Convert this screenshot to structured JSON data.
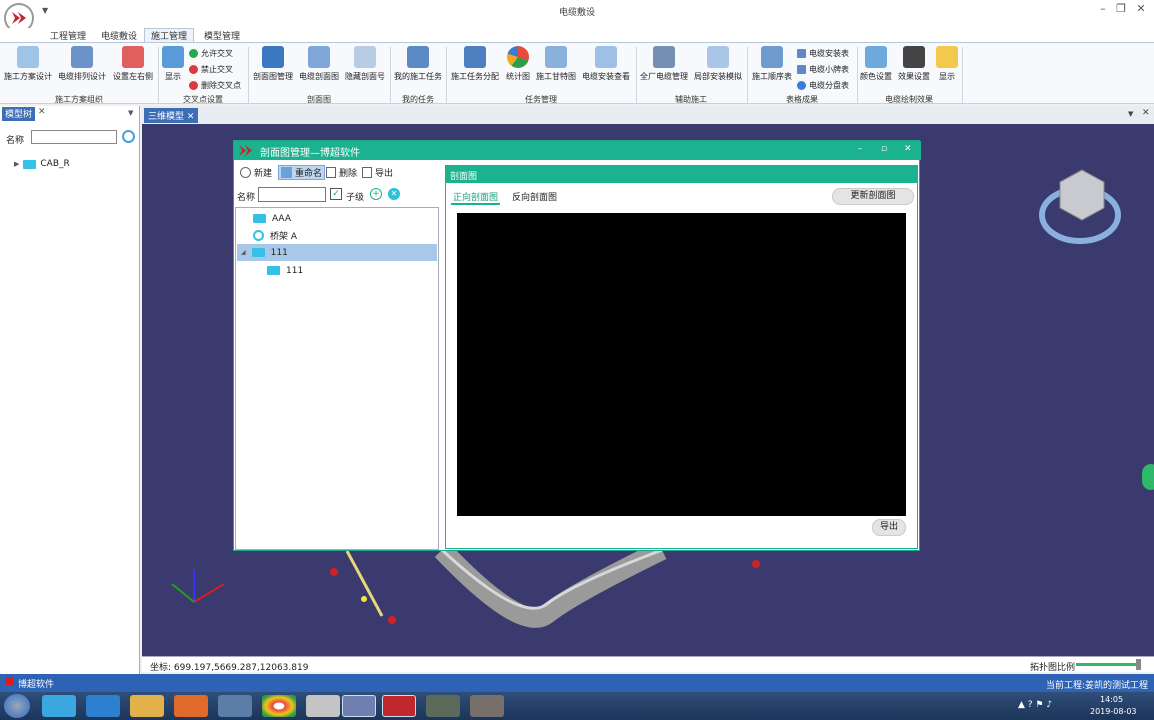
{
  "window": {
    "title": "电缆敷设"
  },
  "ribbon_tabs": [
    "工程管理",
    "电缆敷设",
    "施工管理",
    "模型管理"
  ],
  "ribbon": {
    "buttons": [
      {
        "label": "施工方案设计"
      },
      {
        "label": "电缆排列设计"
      },
      {
        "label": "设置左右侧"
      },
      {
        "label": "显示"
      },
      {
        "label": "剖面图管理"
      },
      {
        "label": "电缆剖面图"
      },
      {
        "label": "隐藏剖面号"
      },
      {
        "label": "我的施工任务"
      },
      {
        "label": "施工任务分配"
      },
      {
        "label": "统计图"
      },
      {
        "label": "施工甘特图"
      },
      {
        "label": "电缆安装查看"
      },
      {
        "label": "全厂电缆管理"
      },
      {
        "label": "局部安装模拟"
      },
      {
        "label": "施工顺序表"
      },
      {
        "label": "颜色设置"
      },
      {
        "label": "效果设置"
      },
      {
        "label": "显示"
      }
    ],
    "small_buttons": [
      {
        "label": "允许交叉"
      },
      {
        "label": "禁止交叉"
      },
      {
        "label": "删除交叉点"
      },
      {
        "label": "电缆安装表"
      },
      {
        "label": "电缆小牌表"
      },
      {
        "label": "电缆分盘表"
      }
    ],
    "groups": [
      "施工方案组织",
      "交叉点设置",
      "剖面图",
      "我的任务",
      "任务管理",
      "辅助施工",
      "表格成果",
      "电缆绘制效果"
    ]
  },
  "left_panel": {
    "tab": "模型树",
    "name_label": "名称",
    "tree_root": "CAB_R"
  },
  "view_tab": "三维模型",
  "coords": "坐标: 699.197,5669.287,12063.819",
  "scale_label": "拓扑图比例",
  "status_left": "博超软件",
  "status_right": "当前工程:姜凯的测试工程",
  "clock": {
    "time": "14:05",
    "date": "2019-08-03"
  },
  "dialog": {
    "title": "剖面图管理—博超软件",
    "toolbar": [
      "新建",
      "重命名",
      "删除",
      "导出"
    ],
    "name_label": "名称",
    "child_label": "子级",
    "tree": [
      "AAA",
      "桥架 A",
      "111",
      "111"
    ],
    "right_title": "剖面图",
    "tabs": [
      "正向剖面图",
      "反向剖面图"
    ],
    "update_button": "更新剖面图",
    "export_button": "导出"
  },
  "colors": {
    "accent": "#1ab28f",
    "view_bg": "#3a3a6e",
    "statusbar": "#2d62b5"
  }
}
